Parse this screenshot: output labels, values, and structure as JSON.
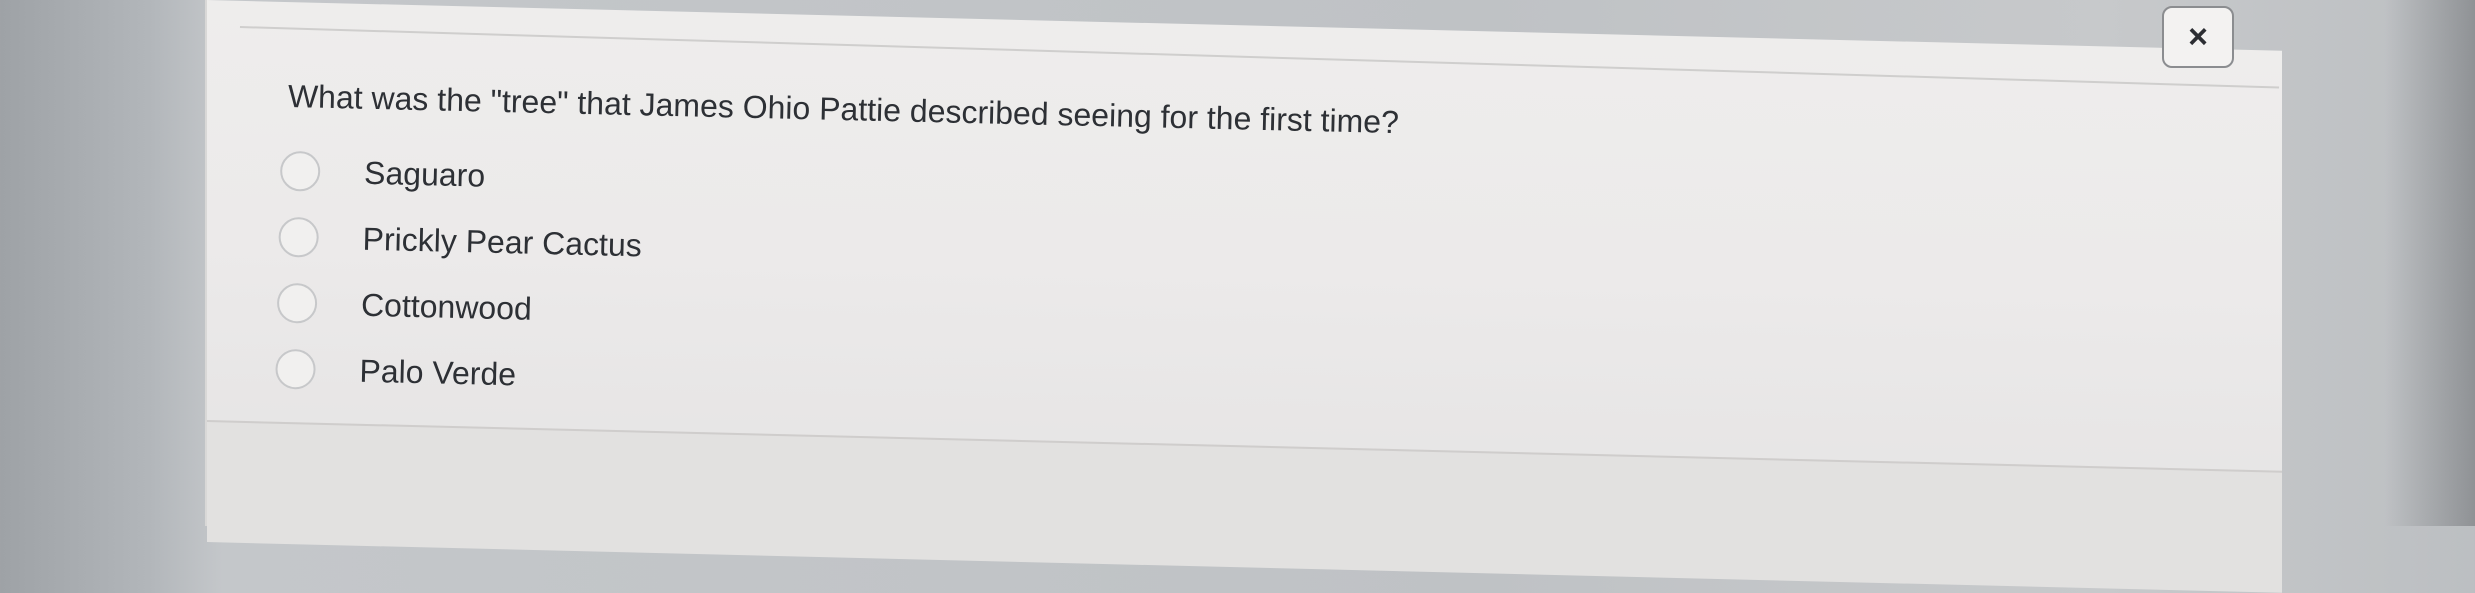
{
  "dialog": {
    "close_label": "×"
  },
  "quiz": {
    "question": "What was the \"tree\" that James Ohio Pattie described seeing for the first time?",
    "options": [
      {
        "label": "Saguaro"
      },
      {
        "label": "Prickly Pear Cactus"
      },
      {
        "label": "Cottonwood"
      },
      {
        "label": "Palo Verde"
      }
    ]
  }
}
